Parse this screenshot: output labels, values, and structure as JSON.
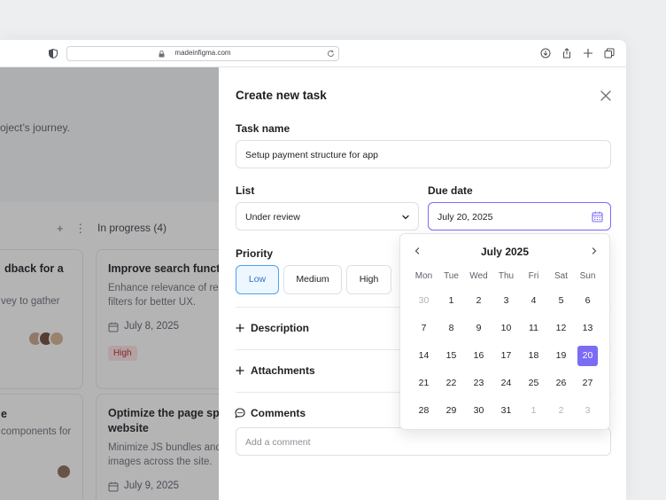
{
  "browser": {
    "url": "madeinfigma.com"
  },
  "background": {
    "description_fragment": "oject’s journey.",
    "column": {
      "title": "In progress (4)",
      "add": "+",
      "more": "⋮"
    },
    "cards": [
      {
        "title": "dback for a",
        "text": [
          "vey to gather"
        ]
      },
      {
        "title": "Improve search functio",
        "text": [
          "Enhance relevance of res",
          "filters for better UX."
        ],
        "date": "July 8, 2025",
        "tag": "High"
      },
      {
        "title": "e",
        "text": [
          "components for"
        ]
      },
      {
        "title": "Optimize the page spe",
        "title2": "website",
        "text": [
          "Minimize JS bundles and",
          "images across the site."
        ],
        "date": "July 9, 2025"
      }
    ]
  },
  "panel": {
    "title": "Create new task",
    "task_name_label": "Task name",
    "task_name_value": "Setup payment structure for app",
    "list_label": "List",
    "list_value": "Under review",
    "due_label": "Due date",
    "due_value": "July 20, 2025",
    "priority_label": "Priority",
    "priority_options": [
      "Low",
      "Medium",
      "High"
    ],
    "priority_selected": "Low",
    "description_label": "Description",
    "attachments_label": "Attachments",
    "comments_label": "Comments",
    "comment_placeholder": "Add a comment"
  },
  "calendar": {
    "month": "July 2025",
    "weekdays": [
      "Mon",
      "Tue",
      "Wed",
      "Thu",
      "Fri",
      "Sat",
      "Sun"
    ],
    "weeks": [
      [
        "30",
        "1",
        "2",
        "3",
        "4",
        "5",
        "6"
      ],
      [
        "7",
        "8",
        "9",
        "10",
        "11",
        "12",
        "13"
      ],
      [
        "14",
        "15",
        "16",
        "17",
        "18",
        "19",
        "20"
      ],
      [
        "21",
        "22",
        "23",
        "24",
        "25",
        "26",
        "27"
      ],
      [
        "28",
        "29",
        "30",
        "31",
        "1",
        "2",
        "3"
      ]
    ],
    "selected": "20"
  },
  "colors": {
    "accent": "#7b6cf5",
    "selected_priority": "#4aa3f0",
    "tag_high_bg": "#fde3e4",
    "tag_high_text": "#b5262b"
  }
}
